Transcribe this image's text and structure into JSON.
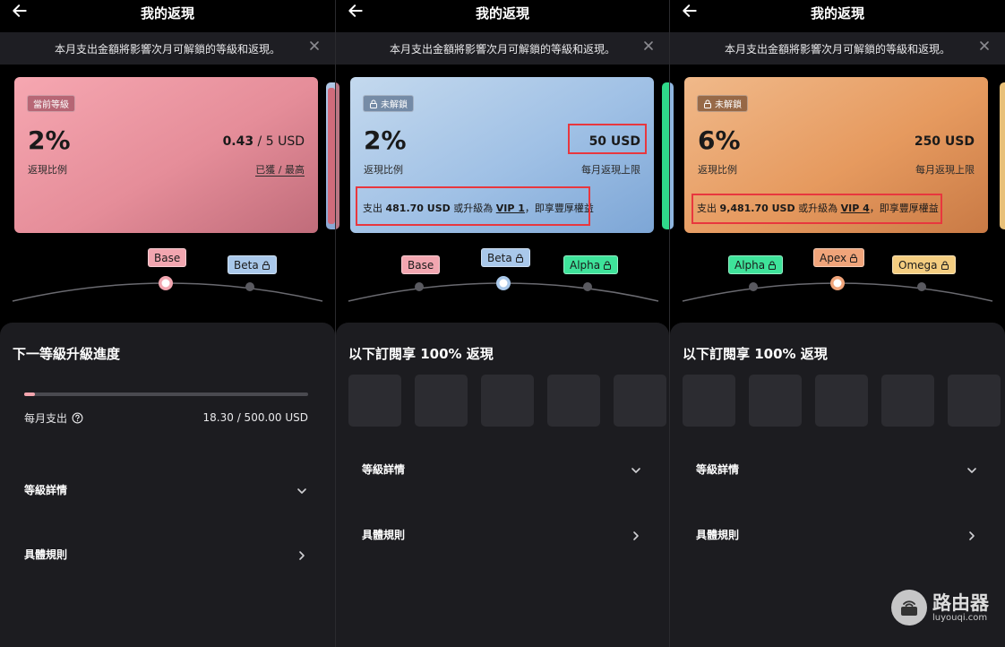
{
  "header": {
    "title": "我的返現"
  },
  "banner": {
    "text": "本月支出金額將影響次月可解鎖的等級和返現。"
  },
  "screens": [
    {
      "card": {
        "badge": "當前等級",
        "rate": "2%",
        "rate_label": "返現比例",
        "amount_bold": "0.43",
        "amount_rest": " / 5 USD",
        "amount_label": "已獲 / 最高"
      },
      "tiers": {
        "left": "Base",
        "right": "Beta"
      },
      "panel": {
        "title": "下一等級升級進度",
        "spend_label": "每月支出",
        "spend_value": "18.30 / 500.00 USD",
        "progress_fraction": 0.0366,
        "row1": "等級詳情",
        "row2": "具體規則"
      }
    },
    {
      "card": {
        "badge": "未解鎖",
        "rate": "2%",
        "rate_label": "返現比例",
        "amount": "50 USD",
        "amount_label": "每月返現上限",
        "cond_pre": "支出 ",
        "cond_amount": "481.70 USD",
        "cond_mid": " 或升級為 ",
        "cond_vip": "VIP 1",
        "cond_post": "，即享豐厚權益"
      },
      "tiers": {
        "left": "Base",
        "center": "Beta",
        "right": "Alpha"
      },
      "panel": {
        "title": "以下訂閱享 100% 返現",
        "row1": "等級詳情",
        "row2": "具體規則"
      }
    },
    {
      "card": {
        "badge": "未解鎖",
        "rate": "6%",
        "rate_label": "返現比例",
        "amount": "250 USD",
        "amount_label": "每月返現上限",
        "cond_pre": "支出 ",
        "cond_amount": "9,481.70 USD",
        "cond_mid": " 或升級為 ",
        "cond_vip": "VIP 4",
        "cond_post": "，即享豐厚權益"
      },
      "tiers": {
        "left": "Alpha",
        "center": "Apex",
        "right": "Omega"
      },
      "panel": {
        "title": "以下訂閱享 100% 返現",
        "row1": "等級詳情",
        "row2": "具體規則"
      }
    }
  ],
  "watermark": {
    "title": "路由器",
    "sub": "luyouqi.com"
  },
  "colors": {
    "highlight": "#e8373e",
    "tier_base": "#f2a6b0",
    "tier_beta": "#a9c8ea",
    "tier_alpha": "#3ee39a",
    "tier_apex": "#f0a47a",
    "tier_omega": "#f4cd80"
  }
}
